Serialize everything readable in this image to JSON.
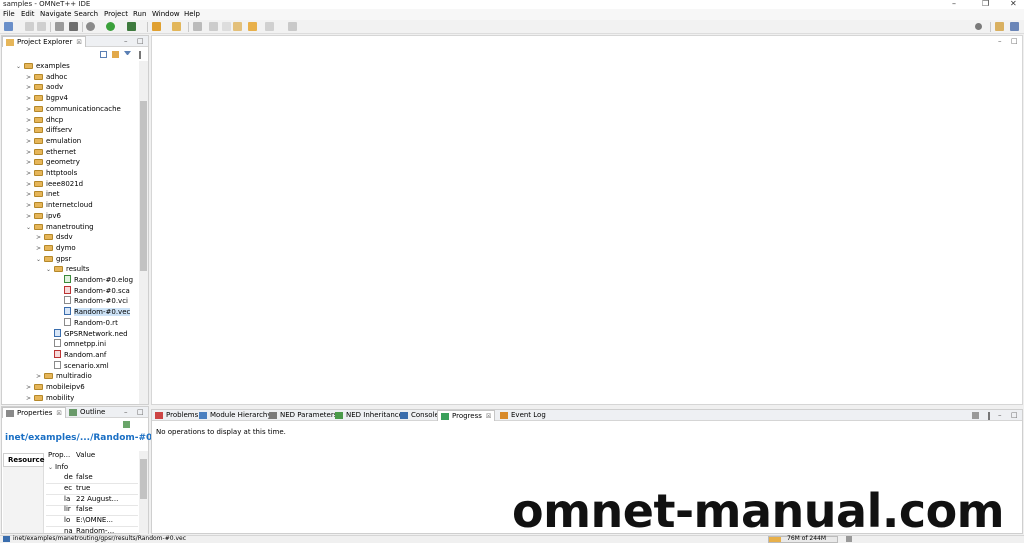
{
  "window": {
    "title": "samples - OMNeT++ IDE"
  },
  "window_controls": {
    "minimize": "–",
    "maximize": "❐",
    "close": "✕"
  },
  "menu": [
    "File",
    "Edit",
    "Navigate",
    "Search",
    "Project",
    "Run",
    "Window",
    "Help"
  ],
  "project_explorer": {
    "tab_label": "Project Explorer",
    "tab_close": "☒",
    "tree": [
      {
        "label": "examples",
        "kind": "folder",
        "arrow": "⌄"
      },
      {
        "label": "adhoc",
        "kind": "folder",
        "arrow": ">"
      },
      {
        "label": "aodv",
        "kind": "folder",
        "arrow": ">"
      },
      {
        "label": "bgpv4",
        "kind": "folder",
        "arrow": ">"
      },
      {
        "label": "communicationcache",
        "kind": "folder",
        "arrow": ">"
      },
      {
        "label": "dhcp",
        "kind": "folder",
        "arrow": ">"
      },
      {
        "label": "diffserv",
        "kind": "folder",
        "arrow": ">"
      },
      {
        "label": "emulation",
        "kind": "folder",
        "arrow": ">"
      },
      {
        "label": "ethernet",
        "kind": "folder",
        "arrow": ">"
      },
      {
        "label": "geometry",
        "kind": "folder",
        "arrow": ">"
      },
      {
        "label": "httptools",
        "kind": "folder",
        "arrow": ">"
      },
      {
        "label": "ieee8021d",
        "kind": "folder",
        "arrow": ">"
      },
      {
        "label": "inet",
        "kind": "folder",
        "arrow": ">"
      },
      {
        "label": "internetcloud",
        "kind": "folder",
        "arrow": ">"
      },
      {
        "label": "ipv6",
        "kind": "folder",
        "arrow": ">"
      },
      {
        "label": "manetrouting",
        "kind": "folder",
        "arrow": "⌄"
      },
      {
        "label": "dsdv",
        "kind": "folder",
        "arrow": ">"
      },
      {
        "label": "dymo",
        "kind": "folder",
        "arrow": ">"
      },
      {
        "label": "gpsr",
        "kind": "folder",
        "arrow": "⌄"
      },
      {
        "label": "results",
        "kind": "folder",
        "arrow": "⌄"
      },
      {
        "label": "Random-#0.elog",
        "kind": "file-green",
        "arrow": ""
      },
      {
        "label": "Random-#0.sca",
        "kind": "file-red",
        "arrow": ""
      },
      {
        "label": "Random-#0.vci",
        "kind": "file",
        "arrow": ""
      },
      {
        "label": "Random-#0.vec",
        "kind": "file-blue",
        "arrow": "",
        "selected": true
      },
      {
        "label": "Random-0.rt",
        "kind": "file",
        "arrow": ""
      },
      {
        "label": "GPSRNetwork.ned",
        "kind": "file-blue",
        "arrow": ""
      },
      {
        "label": "omnetpp.ini",
        "kind": "file",
        "arrow": ""
      },
      {
        "label": "Random.anf",
        "kind": "file-red",
        "arrow": ""
      },
      {
        "label": "scenario.xml",
        "kind": "file",
        "arrow": ""
      },
      {
        "label": "multiradio",
        "kind": "folder",
        "arrow": ">"
      },
      {
        "label": "mobileipv6",
        "kind": "folder",
        "arrow": ">"
      },
      {
        "label": "mobility",
        "kind": "folder",
        "arrow": ">"
      }
    ]
  },
  "properties": {
    "tabs": [
      "Properties",
      "Outline"
    ],
    "tab_close": "☒",
    "header": "inet/examples/.../Random-#0.vec",
    "side_tab": "Resource",
    "columns": [
      "Prop...",
      "Value"
    ],
    "group": "Info",
    "rows": [
      {
        "key": "de",
        "value": "false"
      },
      {
        "key": "ec",
        "value": "true"
      },
      {
        "key": "la",
        "value": "22 August..."
      },
      {
        "key": "lir",
        "value": "false"
      },
      {
        "key": "lo",
        "value": "E:\\OMNE..."
      },
      {
        "key": "na",
        "value": "Random-..."
      }
    ]
  },
  "bottom_panel": {
    "tabs": [
      "Problems",
      "Module Hierarchy",
      "NED Parameters",
      "NED Inheritance",
      "Console",
      "Progress",
      "Event Log"
    ],
    "active_tab": "Progress",
    "tab_close": "☒",
    "message": "No operations to display at this time."
  },
  "status": {
    "path": "inet/examples/manetrouting/gpsr/results/Random-#0.vec",
    "memory": "76M of 244M"
  },
  "watermark": "omnet-manual.com",
  "colors": {
    "header_link": "#1a6fc4",
    "folder": "#e6b65a",
    "selection": "#cde3f7"
  }
}
